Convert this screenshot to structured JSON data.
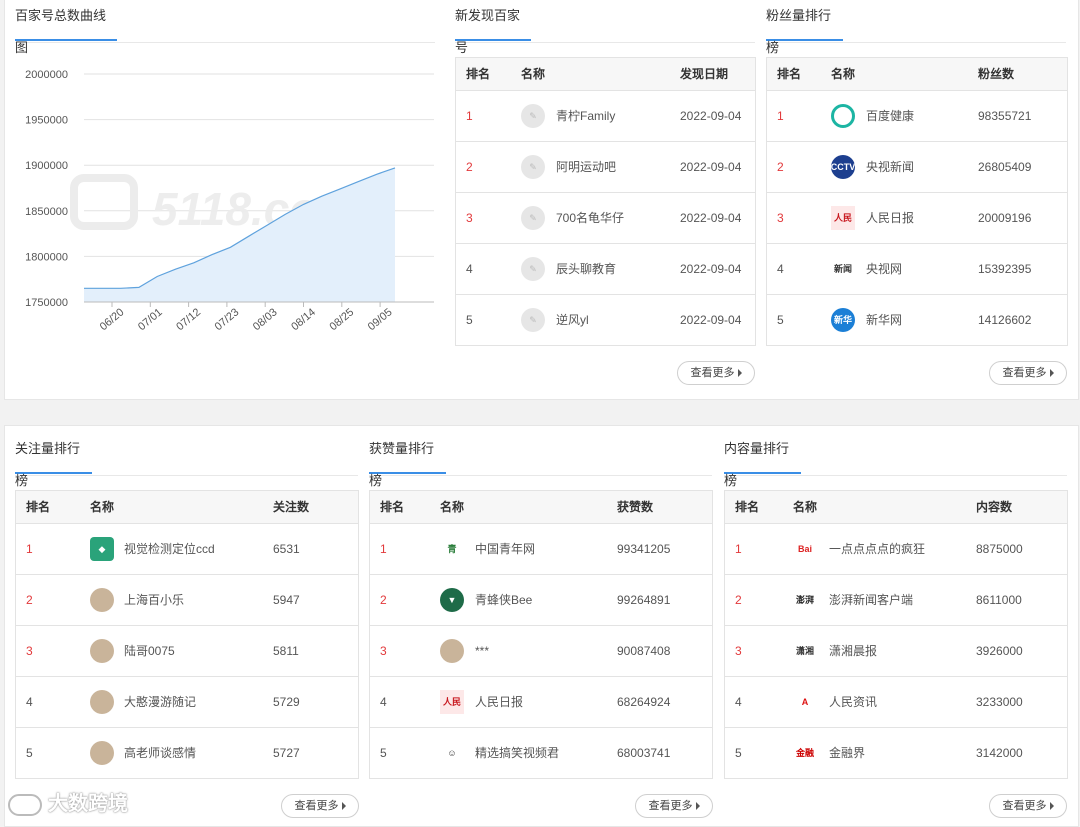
{
  "chart_section": {
    "title": "百家号总数曲线图",
    "watermark": "5118.com"
  },
  "chart_data": {
    "type": "area",
    "x_labels": [
      "06/20",
      "07/01",
      "07/12",
      "07/23",
      "08/03",
      "08/14",
      "08/25",
      "09/05"
    ],
    "y_ticks": [
      2000000,
      1950000,
      1900000,
      1850000,
      1800000,
      1750000
    ],
    "ylim": [
      1750000,
      2000000
    ],
    "series": [
      {
        "values": [
          1765000,
          1765000,
          1765000,
          1766000,
          1778000,
          1786000,
          1793000,
          1802000,
          1810000,
          1822000,
          1834000,
          1846000,
          1857000,
          1866000,
          1874000,
          1882000,
          1890000,
          1897000
        ]
      }
    ],
    "area_color": "#e3effb",
    "line_color": "#5fa2dd",
    "grid": true
  },
  "new_discover": {
    "title": "新发现百家号",
    "headers": {
      "rank": "排名",
      "name": "名称",
      "metric": "发现日期"
    },
    "rows": [
      {
        "rank": "1",
        "name": "青柠Family",
        "value": "2022-09-04",
        "icon": "default-avatar-icon"
      },
      {
        "rank": "2",
        "name": "阿明运动吧",
        "value": "2022-09-04",
        "icon": "default-avatar-icon"
      },
      {
        "rank": "3",
        "name": "700名龟华仔",
        "value": "2022-09-04",
        "icon": "default-avatar-icon"
      },
      {
        "rank": "4",
        "name": "辰头聊教育",
        "value": "2022-09-04",
        "icon": "default-avatar-icon"
      },
      {
        "rank": "5",
        "name": "逆风yl",
        "value": "2022-09-04",
        "icon": "default-avatar-icon"
      }
    ],
    "more": "查看更多"
  },
  "fans_rank": {
    "title": "粉丝量排行榜",
    "headers": {
      "rank": "排名",
      "name": "名称",
      "metric": "粉丝数"
    },
    "rows": [
      {
        "rank": "1",
        "name": "百度健康",
        "value": "98355721",
        "icon": "baidu-health-logo"
      },
      {
        "rank": "2",
        "name": "央视新闻",
        "value": "26805409",
        "icon": "cctv-news-logo"
      },
      {
        "rank": "3",
        "name": "人民日报",
        "value": "20009196",
        "icon": "peoples-daily-logo"
      },
      {
        "rank": "4",
        "name": "央视网",
        "value": "15392395",
        "icon": "cctv-net-logo"
      },
      {
        "rank": "5",
        "name": "新华网",
        "value": "14126602",
        "icon": "xinhua-logo"
      }
    ],
    "more": "查看更多"
  },
  "follow_rank": {
    "title": "关注量排行榜",
    "headers": {
      "rank": "排名",
      "name": "名称",
      "metric": "关注数"
    },
    "rows": [
      {
        "rank": "1",
        "name": "视觉检测定位ccd",
        "value": "6531",
        "icon": "vision-logo"
      },
      {
        "rank": "2",
        "name": "上海百小乐",
        "value": "5947",
        "icon": "avatar-icon"
      },
      {
        "rank": "3",
        "name": "陆哥0075",
        "value": "5811",
        "icon": "avatar-icon"
      },
      {
        "rank": "4",
        "name": "大憨漫游随记",
        "value": "5729",
        "icon": "avatar-icon"
      },
      {
        "rank": "5",
        "name": "高老师谈感情",
        "value": "5727",
        "icon": "avatar-icon"
      }
    ],
    "more": "查看更多"
  },
  "like_rank": {
    "title": "获赞量排行榜",
    "headers": {
      "rank": "排名",
      "name": "名称",
      "metric": "获赞数"
    },
    "rows": [
      {
        "rank": "1",
        "name": "中国青年网",
        "value": "99341205",
        "icon": "youth-net-logo"
      },
      {
        "rank": "2",
        "name": "青蜂侠Bee",
        "value": "99264891",
        "icon": "bee-logo"
      },
      {
        "rank": "3",
        "name": "***",
        "value": "90087408",
        "icon": "avatar-icon"
      },
      {
        "rank": "4",
        "name": "人民日报",
        "value": "68264924",
        "icon": "peoples-daily-logo"
      },
      {
        "rank": "5",
        "name": "精选搞笑视频君",
        "value": "68003741",
        "icon": "cartoon-avatar-icon"
      }
    ],
    "more": "查看更多"
  },
  "content_rank": {
    "title": "内容量排行榜",
    "headers": {
      "rank": "排名",
      "name": "名称",
      "metric": "内容数"
    },
    "rows": [
      {
        "rank": "1",
        "name": "一点点点点的疯狂",
        "value": "8875000",
        "icon": "baidu-logo"
      },
      {
        "rank": "2",
        "name": "澎湃新闻客户端",
        "value": "8611000",
        "icon": "thepaper-logo"
      },
      {
        "rank": "3",
        "name": "潇湘晨报",
        "value": "3926000",
        "icon": "xiaoxiang-logo"
      },
      {
        "rank": "4",
        "name": "人民资讯",
        "value": "3233000",
        "icon": "people-info-logo"
      },
      {
        "rank": "5",
        "name": "金融界",
        "value": "3142000",
        "icon": "jrj-logo"
      }
    ],
    "more": "查看更多"
  },
  "footer_watermark": "大数跨境"
}
